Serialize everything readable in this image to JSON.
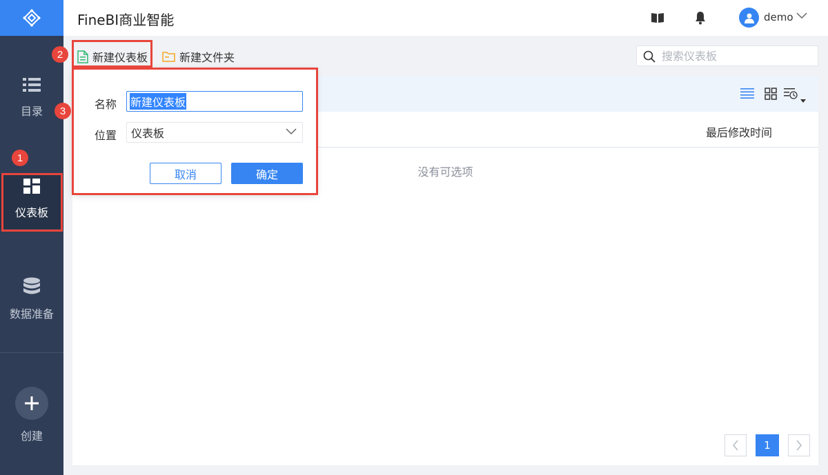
{
  "app_title": "FineBI商业智能",
  "sidebar": {
    "items": [
      {
        "label": "目录",
        "icon": "list-icon"
      },
      {
        "label": "仪表板",
        "icon": "dashboard-icon"
      },
      {
        "label": "数据准备",
        "icon": "database-icon"
      }
    ],
    "create_label": "创建"
  },
  "header": {
    "user_name": "demo",
    "icons": [
      "book-icon",
      "bell-icon",
      "user-avatar-icon",
      "chevron-down-icon"
    ]
  },
  "toolbar": {
    "new_dashboard": "新建仪表板",
    "new_folder": "新建文件夹",
    "search_placeholder": "搜索仪表板"
  },
  "table": {
    "column_last_modified": "最后修改时间",
    "empty_text": "没有可选项"
  },
  "dialog": {
    "name_label": "名称",
    "name_value": "新建仪表板",
    "location_label": "位置",
    "location_value": "仪表板",
    "cancel_label": "取消",
    "confirm_label": "确定"
  },
  "pagination": {
    "current_page": "1"
  },
  "annotations": {
    "step1": "1",
    "step2": "2",
    "step3": "3"
  },
  "colors": {
    "accent": "#3685f2",
    "sidebar": "#2f3d57",
    "annotation": "#e8453c"
  }
}
